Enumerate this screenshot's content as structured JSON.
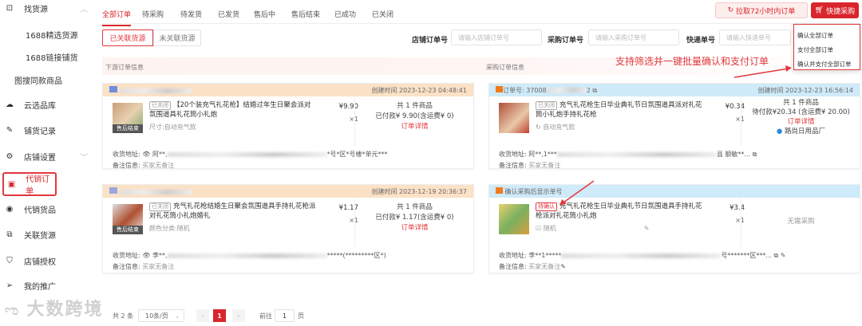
{
  "sidebar": {
    "items": [
      {
        "label": "找货源",
        "icon": "box-icon"
      },
      {
        "label": "1688精选货源"
      },
      {
        "label": "1688链接铺货"
      },
      {
        "label": "图搜同款商品"
      },
      {
        "label": "云选品库",
        "icon": "cloud-icon"
      },
      {
        "label": "铺货记录",
        "icon": "edit-icon"
      },
      {
        "label": "店铺设置",
        "icon": "store-settings-icon"
      },
      {
        "label": "代销订单",
        "icon": "order-icon"
      },
      {
        "label": "代销货品",
        "icon": "goods-icon"
      },
      {
        "label": "关联货源",
        "icon": "link-icon"
      },
      {
        "label": "店铺授权",
        "icon": "shield-icon"
      },
      {
        "label": "我的推广",
        "icon": "send-icon"
      }
    ]
  },
  "tabs": [
    "全部订单",
    "待采购",
    "待发货",
    "已发货",
    "售后中",
    "售后结束",
    "已成功",
    "已关闭"
  ],
  "buttons": {
    "pull": "拉取72小时内订单",
    "quick": "快捷采购"
  },
  "dropdown": [
    "确认全部订单",
    "支付全部订单",
    "确认并支付全部订单"
  ],
  "annotation": "支持筛选并一键批量确认和支付订单",
  "filter": {
    "linked": "已关联货源",
    "unlinked": "未关联货源",
    "shop_label": "店铺订单号",
    "shop_ph": "请输入店铺订单号",
    "purchase_label": "采购订单号",
    "purchase_ph": "请输入采购订单号",
    "express_label": "快递单号",
    "express_ph": "请输入快递单号"
  },
  "section": {
    "left": "下游订单信息",
    "right": "采购订单信息"
  },
  "orders": [
    {
      "created": "创建时间 2023-12-23 04:48:41",
      "tag": "已关闭",
      "title": "【20个装充气礼花枪】结婚过年生日聚会派对氛围道具礼花筒小礼炮",
      "spec": "尺寸:自动充气款",
      "overlay": "售后结束",
      "price": "¥9.90",
      "qty": "×1",
      "count": "共 1 件商品",
      "paid": "已付款¥ 9.90(含运费¥ 0)",
      "detail": "订单详情",
      "addr_label": "收货地址:",
      "addr": "阿**,",
      "addr_tail": "*号*区*号楼*单元***",
      "note_label": "备注信息:",
      "note": "买家无备注",
      "purchase": {
        "header": "订单号: 37008",
        "header_tail": "2",
        "created": "创建时间 2023-12-23 16:56:14",
        "tag": "已关闭",
        "title": "充气礼花枪生日毕业典礼节日氛围道具派对礼花筒小礼炮手持礼花枪",
        "spec": "自动充气款",
        "price": "¥0.34",
        "qty": "×1",
        "count": "共 1 件商品",
        "paid": "待付款¥20.34 (含运费¥ 20.00)",
        "detail": "订单详情",
        "shop": "路尚日用品厂",
        "addr": "阿**,1***",
        "addr_tail": "县 额敏**...",
        "note": "买家无备注"
      }
    },
    {
      "created": "创建时间 2023-12-19 20:36:37",
      "tag": "已关闭",
      "title": "充气礼花枪结婚生日聚会氛围道具手持礼花枪派对礼花筒小礼炮婚礼",
      "spec": "颜色分类:随机",
      "overlay": "售后结束",
      "price": "¥1.17",
      "qty": "×1",
      "count": "共 1 件商品",
      "paid": "已付款¥ 1.17(含运费¥ 0)",
      "detail": "订单详情",
      "addr_label": "收货地址:",
      "addr": "李**,",
      "addr_tail": "*****(*********区*)",
      "note_label": "备注信息:",
      "note": "买家无备注",
      "purchase": {
        "header": "确认采购后显示单号",
        "tag": "待确认",
        "title": "充气礼花枪生日毕业典礼节日氛围道具手持礼花枪派对礼花筒小礼炮",
        "spec": "随机",
        "price": "¥3.4",
        "qty": "×1",
        "status": "无需采购",
        "addr": "李**1*****",
        "addr_tail": "号*******区***...",
        "note": "买家无备注"
      }
    }
  ],
  "pagination": {
    "total": "共 2 条",
    "per_page": "10条/页",
    "current": "1",
    "goto": "前往",
    "goto_value": "1",
    "page_unit": "页"
  },
  "watermark": "大数跨境"
}
